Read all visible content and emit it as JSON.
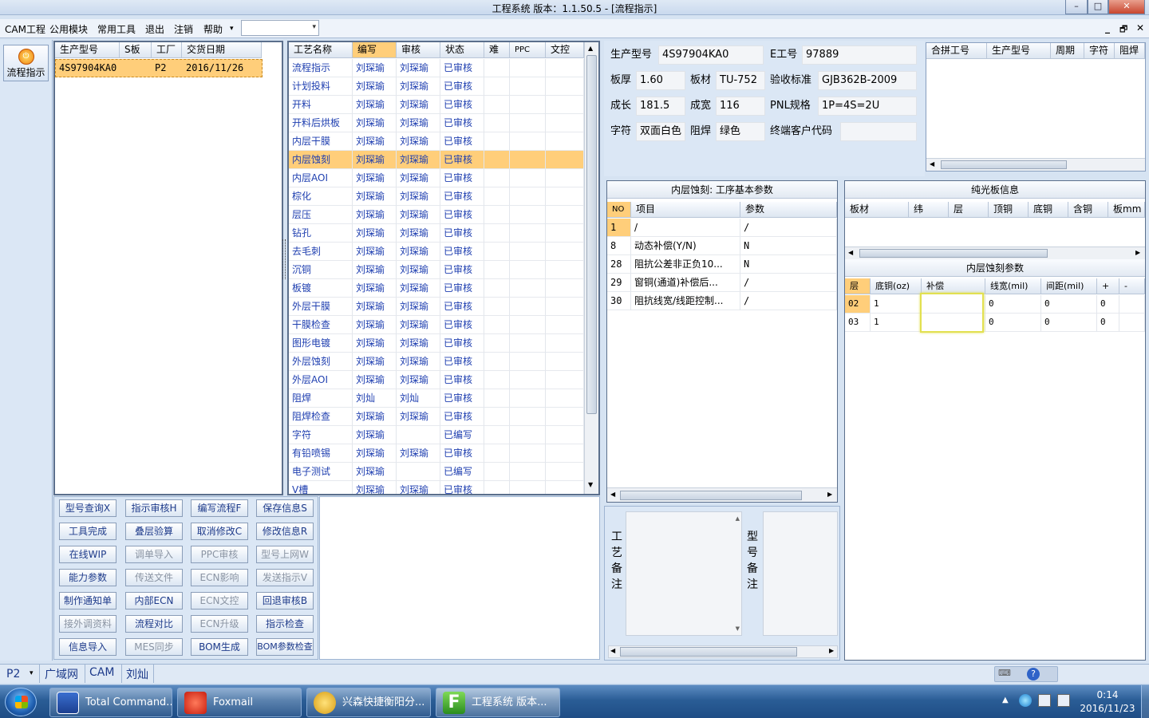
{
  "window": {
    "title": "工程系统    版本：1.1.50.5 - [流程指示]",
    "min": "–",
    "max": "□",
    "close": "✕"
  },
  "menu": {
    "items": [
      "CAM工程",
      "公用模块",
      "常用工具",
      "退出",
      "注销",
      "帮助"
    ],
    "help_arrow": "▾",
    "combo_value": "",
    "mdi_controls": [
      "_",
      "🗗",
      "✕"
    ]
  },
  "leftstrip": {
    "flow_button": "流程指示"
  },
  "orders": {
    "headers": [
      "生产型号",
      "S板",
      "工厂",
      "交货日期"
    ],
    "rows": [
      [
        "4S97904KA0",
        "",
        "P2",
        "2016/11/26"
      ]
    ]
  },
  "process": {
    "headers": [
      "工艺名称",
      "编写",
      "审核",
      "状态",
      "难",
      "PPC",
      "文控"
    ],
    "rows": [
      [
        "流程指示",
        "刘琛瑜",
        "刘琛瑜",
        "已审核"
      ],
      [
        "计划投料",
        "刘琛瑜",
        "刘琛瑜",
        "已审核"
      ],
      [
        "开料",
        "刘琛瑜",
        "刘琛瑜",
        "已审核"
      ],
      [
        "开料后烘板",
        "刘琛瑜",
        "刘琛瑜",
        "已审核"
      ],
      [
        "内层干膜",
        "刘琛瑜",
        "刘琛瑜",
        "已审核"
      ],
      [
        "内层蚀刻",
        "刘琛瑜",
        "刘琛瑜",
        "已审核"
      ],
      [
        "内层AOI",
        "刘琛瑜",
        "刘琛瑜",
        "已审核"
      ],
      [
        "棕化",
        "刘琛瑜",
        "刘琛瑜",
        "已审核"
      ],
      [
        "层压",
        "刘琛瑜",
        "刘琛瑜",
        "已审核"
      ],
      [
        "钻孔",
        "刘琛瑜",
        "刘琛瑜",
        "已审核"
      ],
      [
        "去毛刺",
        "刘琛瑜",
        "刘琛瑜",
        "已审核"
      ],
      [
        "沉铜",
        "刘琛瑜",
        "刘琛瑜",
        "已审核"
      ],
      [
        "板镀",
        "刘琛瑜",
        "刘琛瑜",
        "已审核"
      ],
      [
        "外层干膜",
        "刘琛瑜",
        "刘琛瑜",
        "已审核"
      ],
      [
        "干膜检查",
        "刘琛瑜",
        "刘琛瑜",
        "已审核"
      ],
      [
        "图形电镀",
        "刘琛瑜",
        "刘琛瑜",
        "已审核"
      ],
      [
        "外层蚀刻",
        "刘琛瑜",
        "刘琛瑜",
        "已审核"
      ],
      [
        "外层AOI",
        "刘琛瑜",
        "刘琛瑜",
        "已审核"
      ],
      [
        "阻焊",
        "刘灿",
        "刘灿",
        "已审核"
      ],
      [
        "阻焊检查",
        "刘琛瑜",
        "刘琛瑜",
        "已审核"
      ],
      [
        "字符",
        "刘琛瑜",
        "",
        "已编写"
      ],
      [
        "有铅喷锡",
        "刘琛瑜",
        "刘琛瑜",
        "已审核"
      ],
      [
        "电子测试",
        "刘琛瑜",
        "",
        "已编写"
      ],
      [
        "V槽",
        "刘琛瑜",
        "刘琛瑜",
        "已审核"
      ]
    ],
    "selected_index": 5
  },
  "buttons": [
    [
      "型号查询X",
      "指示审核H",
      "编写流程F",
      "保存信息S"
    ],
    [
      "工具完成",
      "叠层验算",
      "取消修改C",
      "修改信息R"
    ],
    [
      "在线WIP",
      "调单导入",
      "PPC审核",
      "型号上网W"
    ],
    [
      "能力参数",
      "传送文件",
      "ECN影响",
      "发送指示V"
    ],
    [
      "制作通知单",
      "内部ECN",
      "ECN文控",
      "回退审核B"
    ],
    [
      "接外调资料",
      "流程对比",
      "ECN升级",
      "指示检查"
    ],
    [
      "信息导入",
      "MES同步",
      "BOM生成",
      "BOM参数检查"
    ]
  ],
  "buttons_disabled": [
    "调单导入",
    "PPC审核",
    "型号上网W",
    "传送文件",
    "ECN影响",
    "发送指示V",
    "ECN文控",
    "接外调资料",
    "ECN升级",
    "MES同步"
  ],
  "info": {
    "labels": {
      "model": "生产型号",
      "ejob": "E工号",
      "thickness": "板厚",
      "material": "板材",
      "standard": "验收标准",
      "length": "成长",
      "width": "成宽",
      "pnl": "PNL规格",
      "char": "字符",
      "mask": "阻焊",
      "customer": "终端客户代码"
    },
    "values": {
      "model": "4S97904KA0",
      "ejob": "97889",
      "thickness": "1.60",
      "material": "TU-752",
      "standard": "GJB362B-2009",
      "length": "181.5",
      "width": "116",
      "pnl": "1P=4S=2U",
      "char": "双面白色",
      "mask": "绿色",
      "customer": ""
    }
  },
  "merge": {
    "headers": [
      "合拼工号",
      "生产型号",
      "周期",
      "字符",
      "阻焊"
    ]
  },
  "params": {
    "title": "内层蚀刻: 工序基本参数",
    "headers": [
      "NO",
      "项目",
      "参数"
    ],
    "rows": [
      [
        "1",
        "/",
        "/"
      ],
      [
        "8",
        "动态补偿(Y/N)",
        "N"
      ],
      [
        "28",
        "阻抗公差非正负10...",
        "N"
      ],
      [
        "29",
        "窗铜(通道)补偿后...",
        "/"
      ],
      [
        "30",
        "阻抗线宽/线距控制...",
        "/"
      ]
    ]
  },
  "notes": {
    "process_note": "工艺备注",
    "model_note": "型号备注"
  },
  "bare": {
    "title": "纯光板信息",
    "headers": [
      "板材",
      "纬",
      "层",
      "顶铜",
      "底铜",
      "含铜",
      "板mm"
    ]
  },
  "etch": {
    "title": "内层蚀刻参数",
    "headers": [
      "层",
      "底铜(oz)",
      "补偿",
      "线宽(mil)",
      "间距(mil)",
      "+",
      "-"
    ],
    "rows": [
      [
        "02",
        "1",
        "",
        "0",
        "0",
        "0"
      ],
      [
        "03",
        "1",
        "",
        "0",
        "0",
        "0"
      ]
    ]
  },
  "status": {
    "factory": "P2",
    "net": "广域网",
    "app": "CAM",
    "user": "刘灿"
  },
  "taskbar": {
    "start": "start",
    "tasks": [
      "Total Command...",
      "Foxmail",
      "兴森快捷衡阳分...",
      "工程系统    版本..."
    ],
    "time": "0:14",
    "date": "2016/11/23"
  }
}
